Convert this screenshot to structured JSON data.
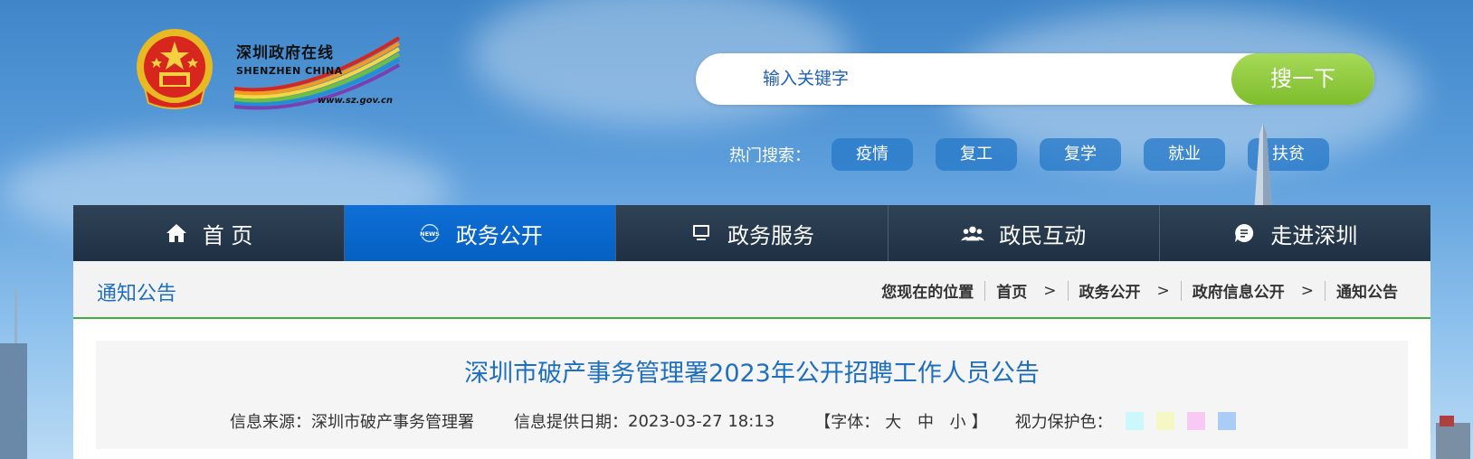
{
  "header": {
    "logo_cn": "深圳政府在线",
    "logo_en": "SHENZHEN CHINA",
    "logo_url": "www.sz.gov.cn"
  },
  "search": {
    "placeholder": "输入关键字",
    "button_label": "搜一下",
    "hot_label": "热门搜索：",
    "hot_tags": [
      "疫情",
      "复工",
      "复学",
      "就业",
      "扶贫"
    ]
  },
  "nav": {
    "items": [
      {
        "label": "首 页",
        "icon": "home-icon"
      },
      {
        "label": "政务公开",
        "icon": "news-icon"
      },
      {
        "label": "政务服务",
        "icon": "monitor-icon"
      },
      {
        "label": "政民互动",
        "icon": "people-icon"
      },
      {
        "label": "走进深圳",
        "icon": "chat-icon"
      }
    ],
    "active_index": 1
  },
  "breadcrumb": {
    "section_title": "通知公告",
    "location_label": "您现在的位置",
    "items": [
      "首页",
      "政务公开",
      "政府信息公开",
      "通知公告"
    ],
    "separator": ">"
  },
  "article": {
    "title": "深圳市破产事务管理署2023年公开招聘工作人员公告",
    "source_label": "信息来源：",
    "source": "深圳市破产事务管理署",
    "date_label": "信息提供日期：",
    "date": "2023-03-27 18:13",
    "font_open": "【字体：",
    "font_large": "大",
    "font_medium": "中",
    "font_small": "小",
    "font_close": "】",
    "eye_label": "视力保护色：",
    "eye_colors": [
      "#ccf7fb",
      "#f5f7c4",
      "#f9c9f5",
      "#a9cdf5"
    ]
  },
  "colors": {
    "brand_blue": "#1f6fc0",
    "search_green": "#8cc63f",
    "nav_dark": "#26394d",
    "nav_active": "#0a66cc",
    "divider_green": "#3fae3f"
  }
}
